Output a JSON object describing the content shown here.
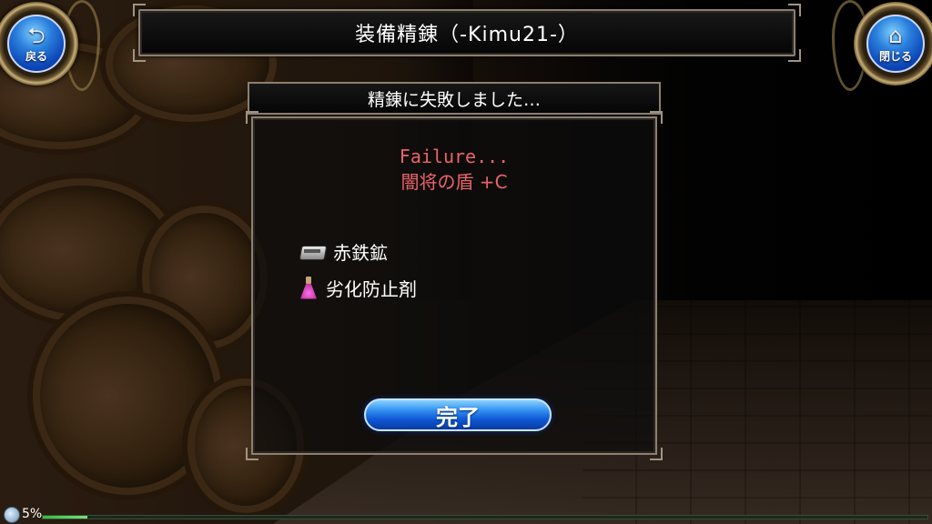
{
  "header": {
    "title": "装備精錬（-Kimu21-）"
  },
  "nav": {
    "back_label": "戻る",
    "back_icon": "back-arrow-icon",
    "close_label": "閉じる",
    "close_icon": "home-icon"
  },
  "dialog": {
    "title": "精錬に失敗しました…",
    "result_en": "Failure...",
    "item_name": "闇将の盾 +C",
    "materials": [
      {
        "name": "赤鉄鉱",
        "icon": "ore-icon"
      },
      {
        "name": "劣化防止剤",
        "icon": "potion-icon"
      }
    ],
    "confirm_label": "完了",
    "colors": {
      "failure": "#e9646a",
      "button": "#1f6fe0"
    }
  },
  "status": {
    "percent_label": "5%",
    "progress": 0.05
  }
}
